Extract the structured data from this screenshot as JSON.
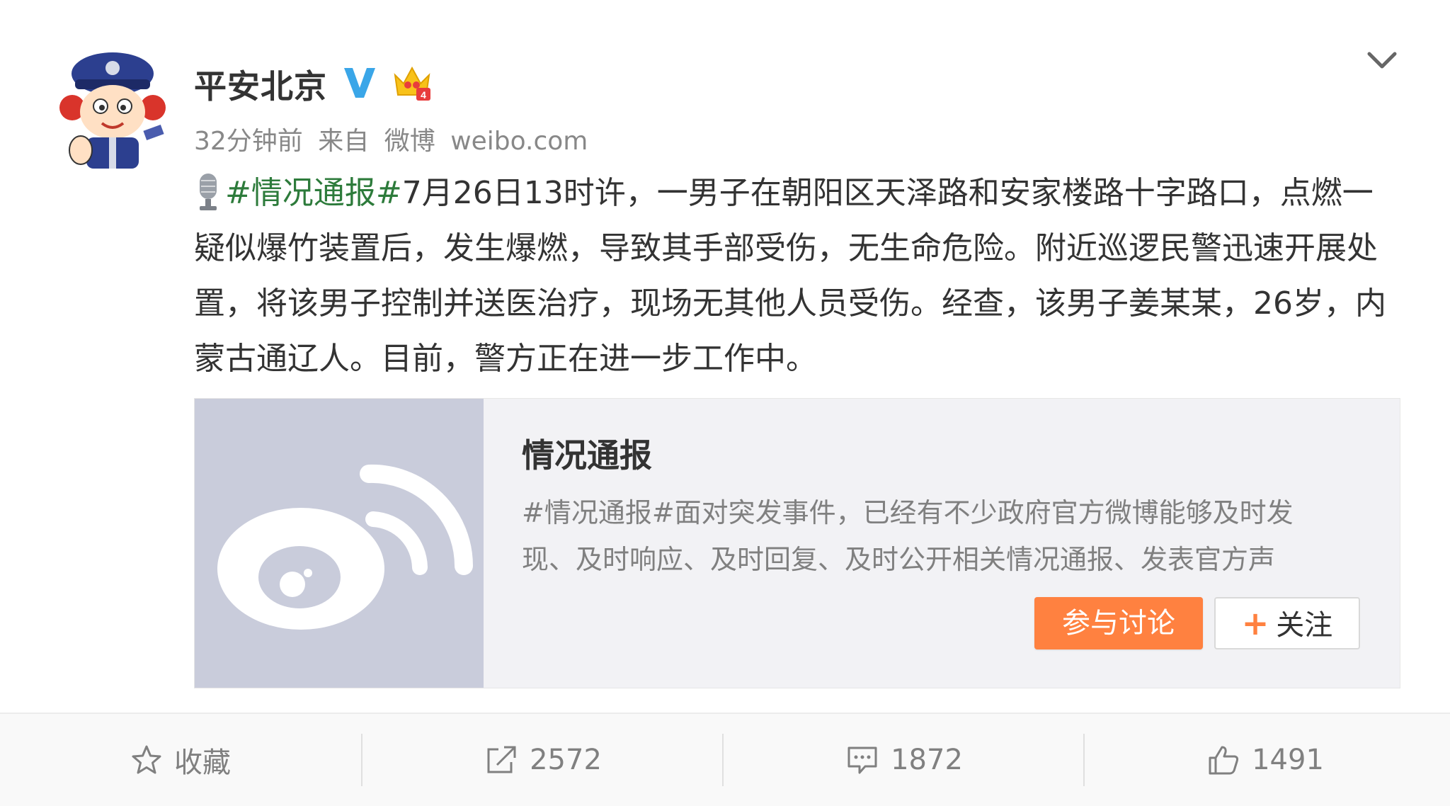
{
  "post": {
    "author": "平安北京",
    "time": "32分钟前",
    "source_prefix": "来自",
    "source_app": "微博",
    "source_domain": "weibo.com",
    "topic_tag": "#情况通报#",
    "body": "7月26日13时许，一男子在朝阳区天泽路和安家楼路十字路口，点燃一疑似爆竹装置后，发生爆燃，导致其手部受伤，无生命危险。附近巡逻民警迅速开展处置，将该男子控制并送医治疗，现场无其他人员受伤。经查，该男子姜某某，26岁，内蒙古通辽人。目前，警方正在进一步工作中。"
  },
  "embed": {
    "title": "情况通报",
    "description": "#情况通报#面对突发事件，已经有不少政府官方微博能够及时发现、及时响应、及时回复、及时公开相关情况通报、发表官方声",
    "discuss_label": "参与讨论",
    "follow_label": "关注"
  },
  "actions": {
    "favorite_label": "收藏",
    "repost_count": "2572",
    "comment_count": "1872",
    "like_count": "1491"
  },
  "colors": {
    "topic_green": "#2d7b3b",
    "accent_orange": "#ff8140",
    "verified_blue": "#3aa6e8"
  },
  "icons": [
    "police-avatar",
    "verified-v-icon",
    "vip-crown-icon",
    "chevron-down-icon",
    "microphone-icon",
    "weibo-logo",
    "star-icon",
    "share-icon",
    "comment-icon",
    "thumbs-up-icon"
  ]
}
